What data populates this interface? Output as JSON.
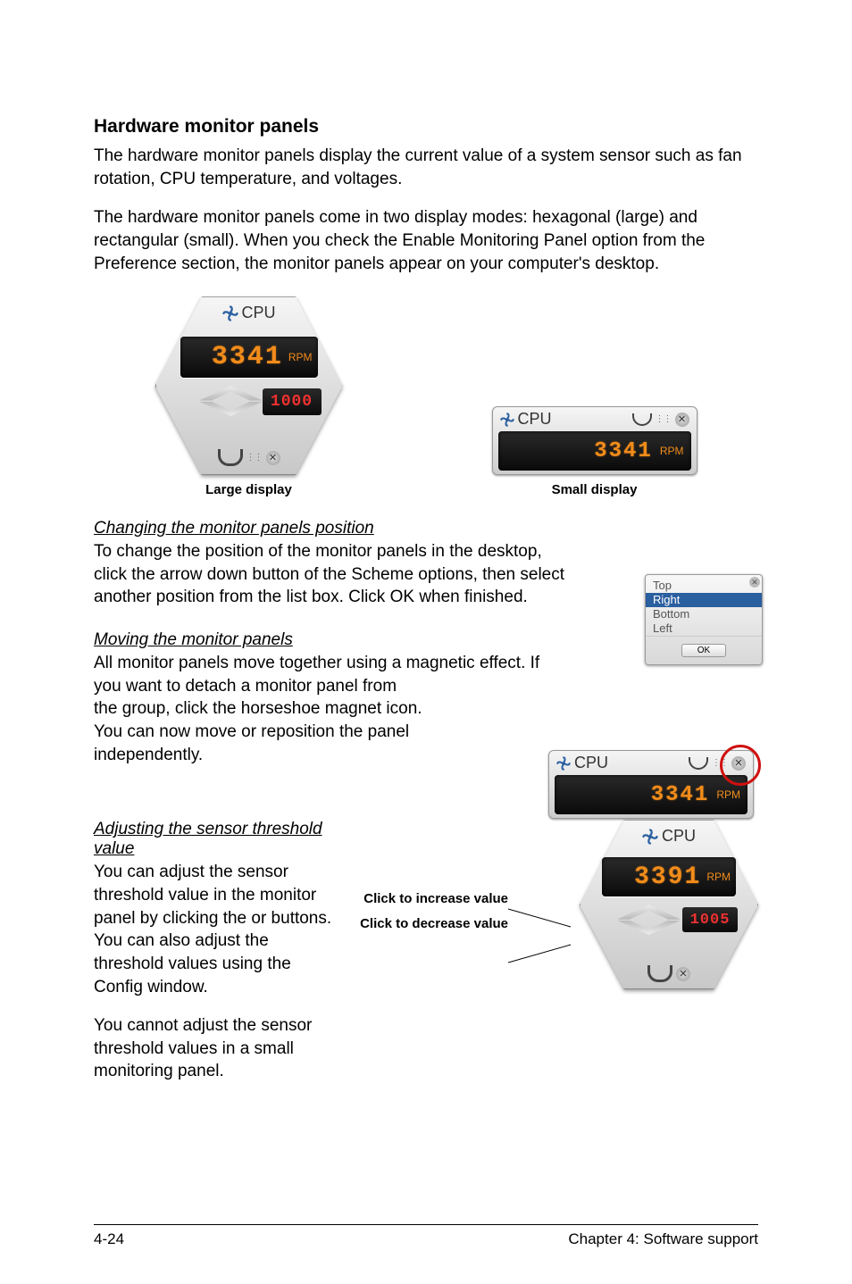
{
  "heading": "Hardware monitor panels",
  "para1": "The hardware monitor panels display the current value of a system sensor such as fan rotation, CPU temperature, and voltages.",
  "para2": "The hardware monitor panels come in two display modes: hexagonal (large) and rectangular (small). When you check the Enable Monitoring Panel option from the Preference section, the monitor panels appear on your computer's desktop.",
  "captions": {
    "large": "Large display",
    "small": "Small display"
  },
  "gauge_large": {
    "title": "CPU",
    "value": "3341",
    "unit": "RPM",
    "threshold": "1000"
  },
  "gauge_small": {
    "title": "CPU",
    "value": "3341",
    "unit": "RPM"
  },
  "section_changing": {
    "title": "Changing the monitor panels position",
    "text": "To change the position of the monitor panels in the desktop, click the arrow down button of the Scheme options, then select another position from the list box. Click OK when finished."
  },
  "dropdown": {
    "items": [
      "Top",
      "Right",
      "Bottom",
      "Left"
    ],
    "selected_index": 1,
    "ok": "OK"
  },
  "section_moving": {
    "title": "Moving the monitor panels",
    "text_a": "All monitor panels move together using a magnetic effect. If",
    "text_b": "you want to detach a monitor panel from the group, click the horseshoe magnet icon. You can now move or reposition the panel independently."
  },
  "gauge_magnet": {
    "title": "CPU",
    "value": "3341",
    "unit": "RPM"
  },
  "section_adjust": {
    "title": "Adjusting the sensor threshold value",
    "text1": "You can adjust the sensor threshold value in the monitor panel by clicking the  or  buttons. You can also adjust the threshold values using the Config window.",
    "text2": "You cannot adjust the sensor threshold values in a small monitoring panel."
  },
  "gauge_adjust": {
    "title": "CPU",
    "value": "3391",
    "unit": "RPM",
    "threshold": "1005"
  },
  "annotations": {
    "increase": "Click to increase value",
    "decrease": "Click to decrease value"
  },
  "footer": {
    "left": "4-24",
    "right": "Chapter 4: Software support"
  }
}
